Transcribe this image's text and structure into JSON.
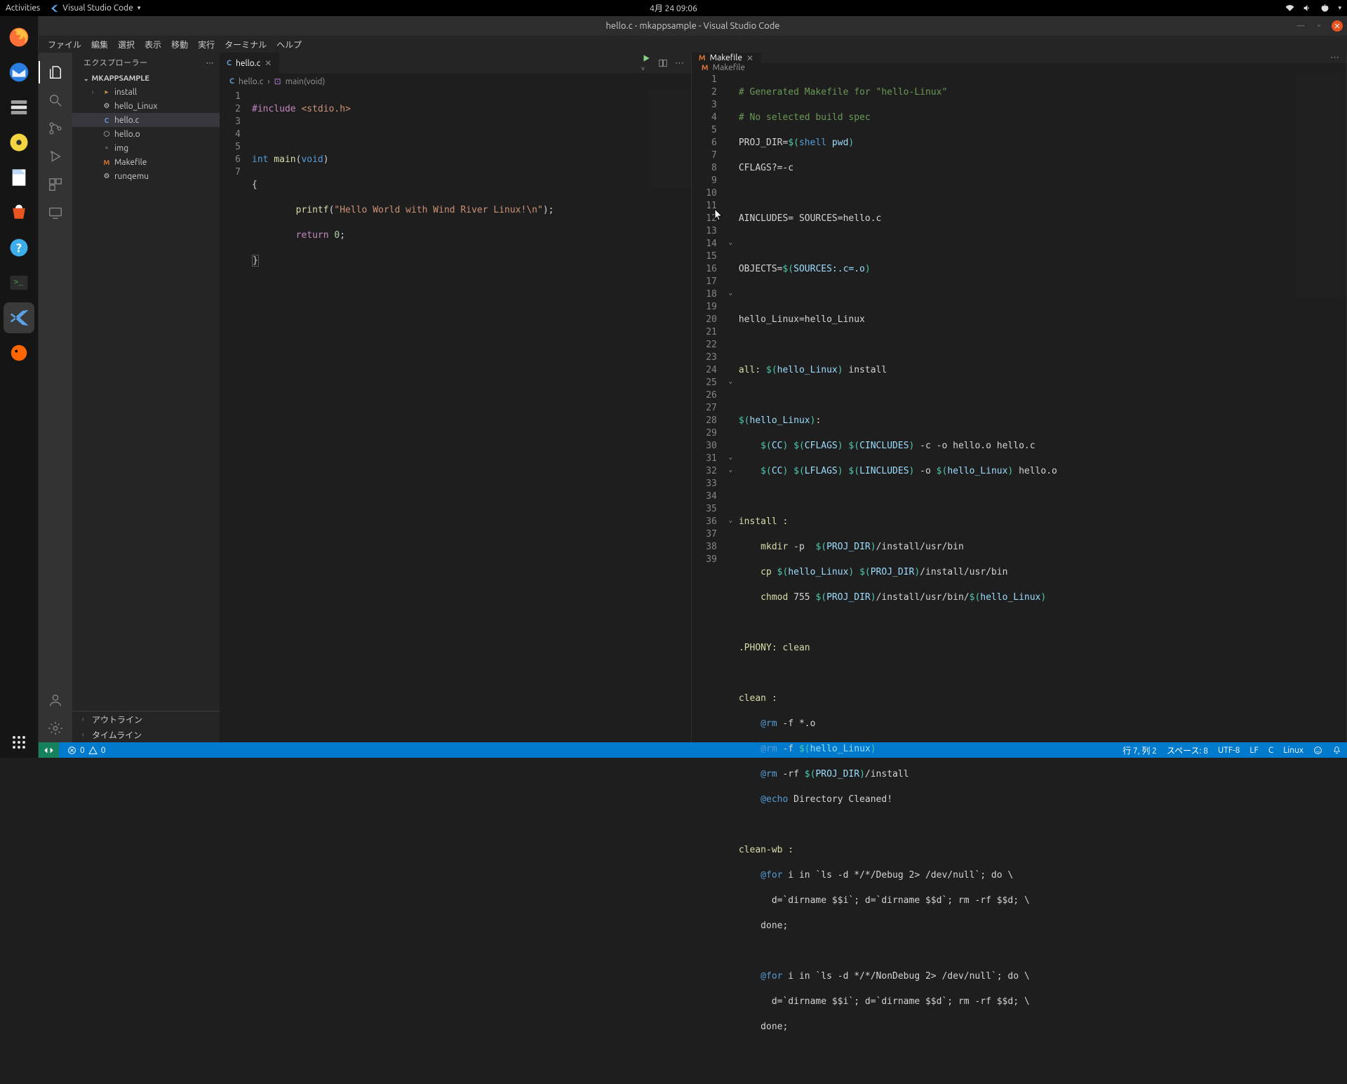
{
  "gnome": {
    "activities": "Activities",
    "app_label": "Visual Studio Code",
    "clock": "4月 24  09:06"
  },
  "titlebar": {
    "title": "hello.c - mkappsample - Visual Studio Code"
  },
  "menus": [
    "ファイル",
    "編集",
    "選択",
    "表示",
    "移動",
    "実行",
    "ターミナル",
    "ヘルプ"
  ],
  "sidebar": {
    "header": "エクスプローラー",
    "project": "MKAPPSAMPLE",
    "items": [
      {
        "label": "install",
        "kind": "folder"
      },
      {
        "label": "hello_Linux",
        "kind": "exe"
      },
      {
        "label": "hello.c",
        "kind": "c",
        "selected": true
      },
      {
        "label": "hello.o",
        "kind": "obj"
      },
      {
        "label": "img",
        "kind": "img"
      },
      {
        "label": "Makefile",
        "kind": "make"
      },
      {
        "label": "runqemu",
        "kind": "exe"
      }
    ],
    "outline": "アウトライン",
    "timeline": "タイムライン"
  },
  "pane1": {
    "tab": "hello.c",
    "breadcrumb_file": "hello.c",
    "breadcrumb_symbol": "main(void)",
    "code": {
      "l1_a": "#include",
      "l1_b": " <stdio.h>",
      "l3_a": "int",
      "l3_b": " main",
      "l3_c": "(",
      "l3_d": "void",
      "l3_e": ")",
      "l4": "{",
      "l5_a": "        printf",
      "l5_b": "(",
      "l5_c": "\"Hello World with Wind River Linux!\\n\"",
      "l5_d": ");",
      "l6_a": "        return",
      "l6_b": " 0",
      "l6_c": ";",
      "l7": "}"
    }
  },
  "pane2": {
    "tab": "Makefile",
    "breadcrumb": "Makefile",
    "code": {
      "l1": "# Generated Makefile for \"hello-Linux\"",
      "l2": "# No selected build spec",
      "l3_a": "PROJ_DIR=",
      "l3_b": "$(",
      "l3_c": "shell",
      "l3_d": " pwd",
      "l3_e": ")",
      "l4": "CFLAGS?=-c",
      "l6": "AINCLUDES= SOURCES=hello.c",
      "l8_a": "OBJECTS=",
      "l8_b": "$(",
      "l8_c": "SOURCES:.c=.o",
      "l8_d": ")",
      "l10": "hello_Linux=hello_Linux",
      "l12_a": "all: ",
      "l12_b": "$(",
      "l12_c": "hello_Linux",
      "l12_d": ")",
      "l12_e": " install",
      "l14_a": "$(",
      "l14_b": "hello_Linux",
      "l14_c": ")",
      "l14_d": ":",
      "l15": "    $(CC) $(CFLAGS) $(CINCLUDES) -c -o hello.o hello.c",
      "l16": "    $(CC) $(LFLAGS) $(LINCLUDES) -o $(hello_Linux) hello.o",
      "l18": "install :",
      "l19": "    mkdir -p  $(PROJ_DIR)/install/usr/bin",
      "l20": "    cp $(hello_Linux) $(PROJ_DIR)/install/usr/bin",
      "l21": "    chmod 755 $(PROJ_DIR)/install/usr/bin/$(hello_Linux)",
      "l23": ".PHONY: clean",
      "l25": "clean :",
      "l26": "    @rm -f *.o",
      "l27": "    @rm -f $(hello_Linux)",
      "l28": "    @rm -rf $(PROJ_DIR)/install",
      "l29": "    @echo Directory Cleaned!",
      "l31": "clean-wb :",
      "l32": "    @for i in `ls -d */*/Debug 2> /dev/null`; do \\",
      "l33": "      d=`dirname $$i`; d=`dirname $$d`; rm -rf $$d; \\",
      "l34": "    done;",
      "l36": "    @for i in `ls -d */*/NonDebug 2> /dev/null`; do \\",
      "l37": "      d=`dirname $$i`; d=`dirname $$d`; rm -rf $$d; \\",
      "l38": "    done;"
    }
  },
  "status": {
    "errors": "0",
    "warnings": "0",
    "pos": "行 7, 列 2",
    "spaces": "スペース: 8",
    "encoding": "UTF-8",
    "eol": "LF",
    "lang": "C",
    "os": "Linux"
  }
}
